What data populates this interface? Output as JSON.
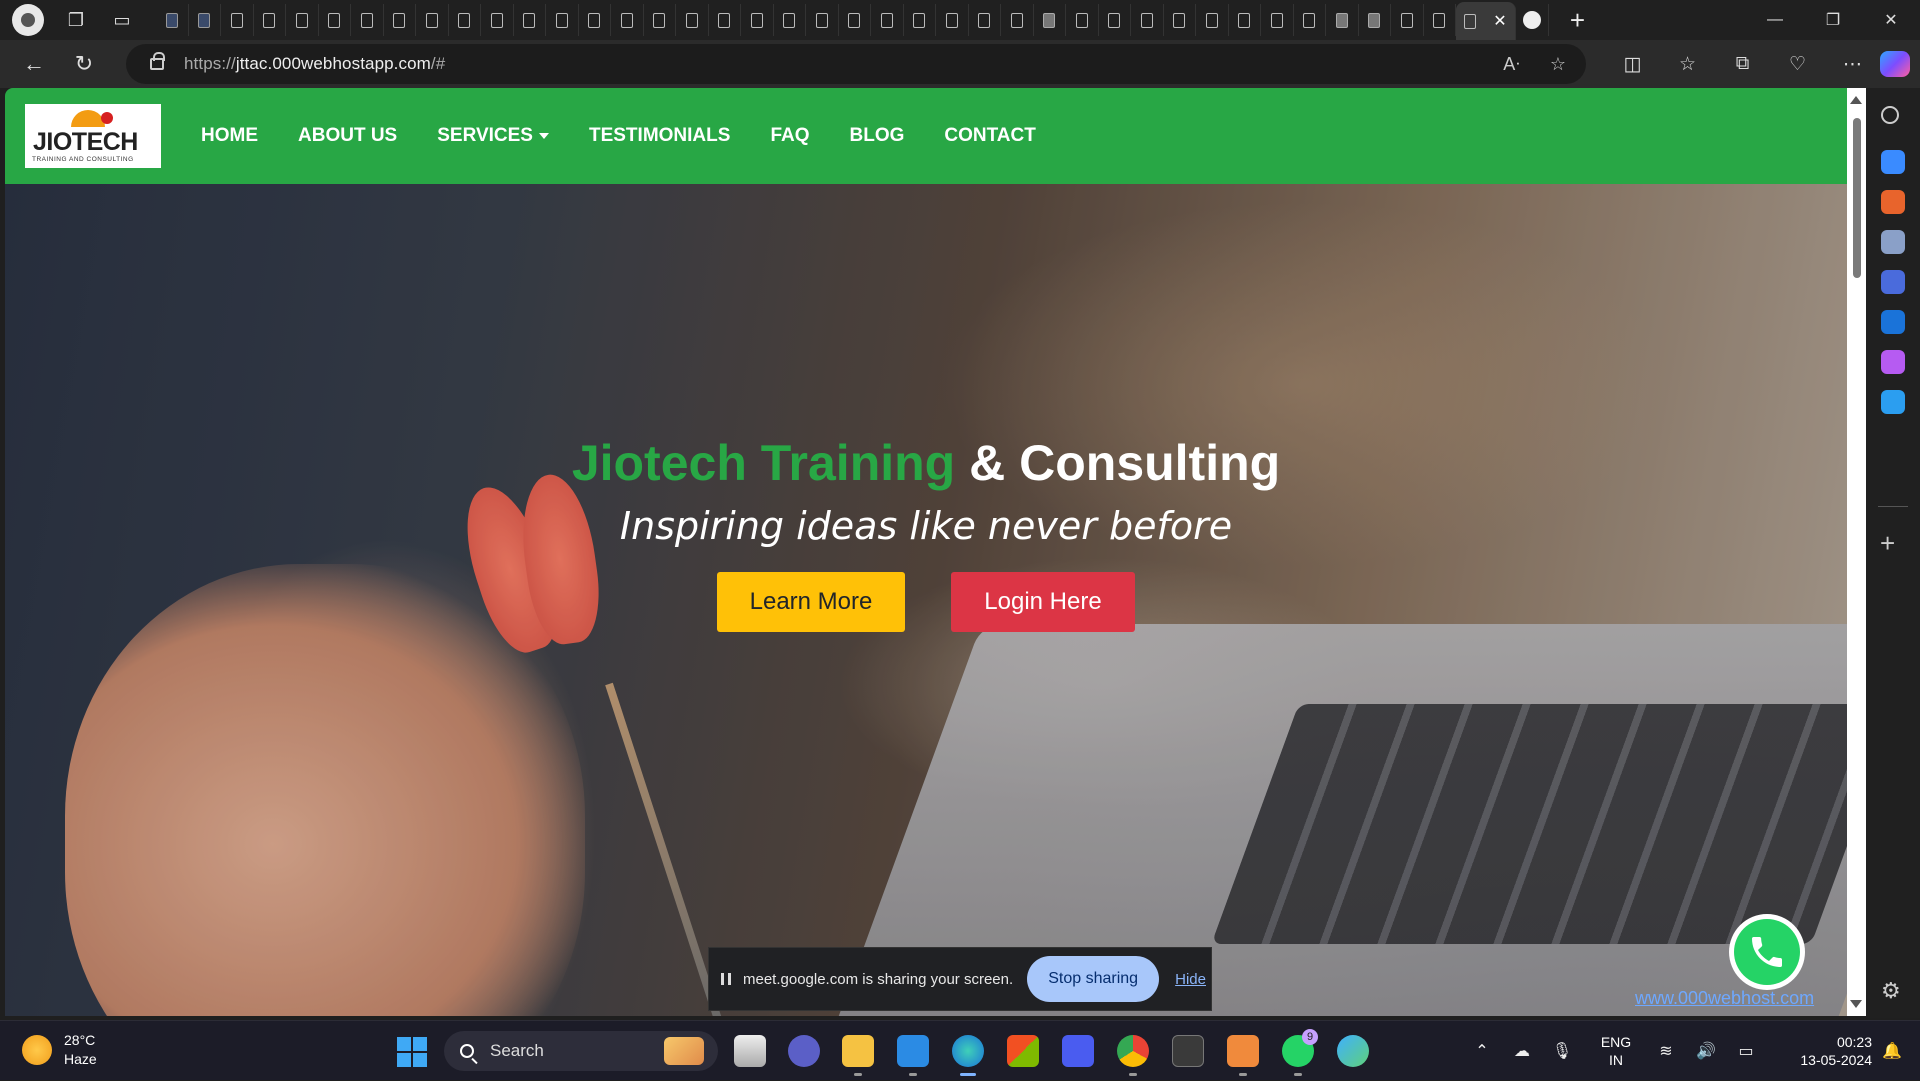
{
  "browser": {
    "url_prefix": "https://",
    "url_host": "jttac.000webhostapp.com",
    "url_suffix": "/#",
    "active_tab_close": "✕",
    "tab_count": 40
  },
  "site": {
    "logo": {
      "name": "JIOTECH",
      "tagline": "TRAINING AND CONSULTING"
    },
    "menu": [
      "HOME",
      "ABOUT US",
      "SERVICES",
      "TESTIMONIALS",
      "FAQ",
      "BLOG",
      "CONTACT"
    ],
    "hero": {
      "title_green": "Jiotech Training",
      "title_white": "& Consulting",
      "subtitle": "Inspiring ideas like never before",
      "learn_more": "Learn More",
      "login_here": "Login Here"
    },
    "hosting_link": "www.000webhost.com",
    "colors": {
      "nav": "#28a745",
      "yellow": "#ffc107",
      "red": "#dc3545"
    }
  },
  "share_bar": {
    "message": "meet.google.com is sharing your screen.",
    "stop_label": "Stop sharing",
    "hide_label": "Hide"
  },
  "taskbar": {
    "temperature": "28°C",
    "condition": "Haze",
    "search_label": "Search",
    "whatsapp_badge": "9",
    "lang_line1": "ENG",
    "lang_line2": "IN",
    "time": "00:23",
    "date": "13-05-2024"
  }
}
